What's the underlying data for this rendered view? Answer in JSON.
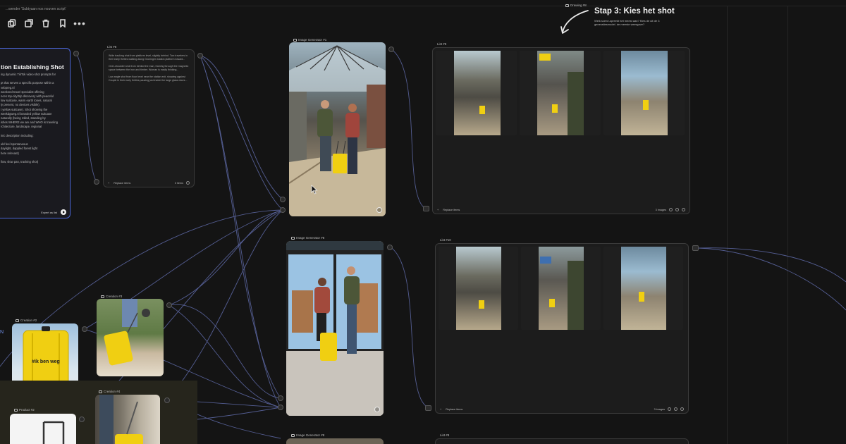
{
  "canvas": {
    "note_text": "...wender 'Subtyaan nos nouven script'",
    "toolbar": {
      "items": [
        "copy-icon",
        "duplicate-icon",
        "trash-icon",
        "bookmark-icon",
        "more-icon"
      ],
      "more_label": "•••"
    }
  },
  "prompt_node": {
    "title": "tion Establishing Shot",
    "body": "ing dynamic TikTok video shot prompts for\n\npt that serves a specific purpose within a\nvebpreg.nl\nweekend travel specialist offering\nnces top-city/trip discovery with peaceful\nlow suitcase, warm earth tones, natural\nly present, no devices visible).\nt yellow suitcase). Shot showing the\nweekdgweg.nl branded yellow suitcase\nnaturally (being rolled, standing by\nishes WHERE we are and WHO is traveling\nrchitecture, landscape, regional\n\ninic description including:\n\nuld feel spontaneous\ndaylight, dappled forest light\nhere relevant)\n\nllow, slow pan, tracking shot)",
    "footer_label": "Expert as list"
  },
  "list_8": {
    "label": "List #8",
    "text": "Wide tracking shot from platform level, slightly behind. Two travelers in their early thirties walking along Groningen station platform toward...\n\nOver-shoulder shot from behind the man, framing through the magnetic space between the iron and timber. Woman is easily thinking...\n\nLow angle shot from floor level near the station exit, showing against Couple in their early thirties pausing just inside the large glass doors...",
    "footer_replace": "Replace items",
    "footer_count": "3 items"
  },
  "image_gen_1": {
    "label": "Image Generator #1"
  },
  "image_gen_2": {
    "label": "Image Generator #8"
  },
  "image_gen_3": {
    "label": "Image Generator #8"
  },
  "list_9": {
    "label": "List #9",
    "footer_replace": "Replace items",
    "footer_count": "3 images"
  },
  "list_10": {
    "label": "List #10",
    "footer_replace": "Replace items",
    "footer_count": "3 images"
  },
  "list_bottom": {
    "label": "List #8"
  },
  "creation_2": {
    "label": "Creation #2"
  },
  "creation_3": {
    "label": "Creation #3"
  },
  "creation_4": {
    "label": "Creation #4"
  },
  "product_2": {
    "label": "Product #2"
  },
  "suitcase_text": "#ik ben weg",
  "drawing": {
    "label": "Drawing #8",
    "title": "Stap 3: Kies het shot",
    "subtitle": "Welk scene-spreekt het meest aan? Kies de uit de 3 generatiesmodel. de meeste weergave?"
  },
  "colors": {
    "background": "#141414",
    "accent_blue": "#4a66d8",
    "suitcase_yellow": "#f0cf12",
    "wire": "#6b73b5"
  }
}
